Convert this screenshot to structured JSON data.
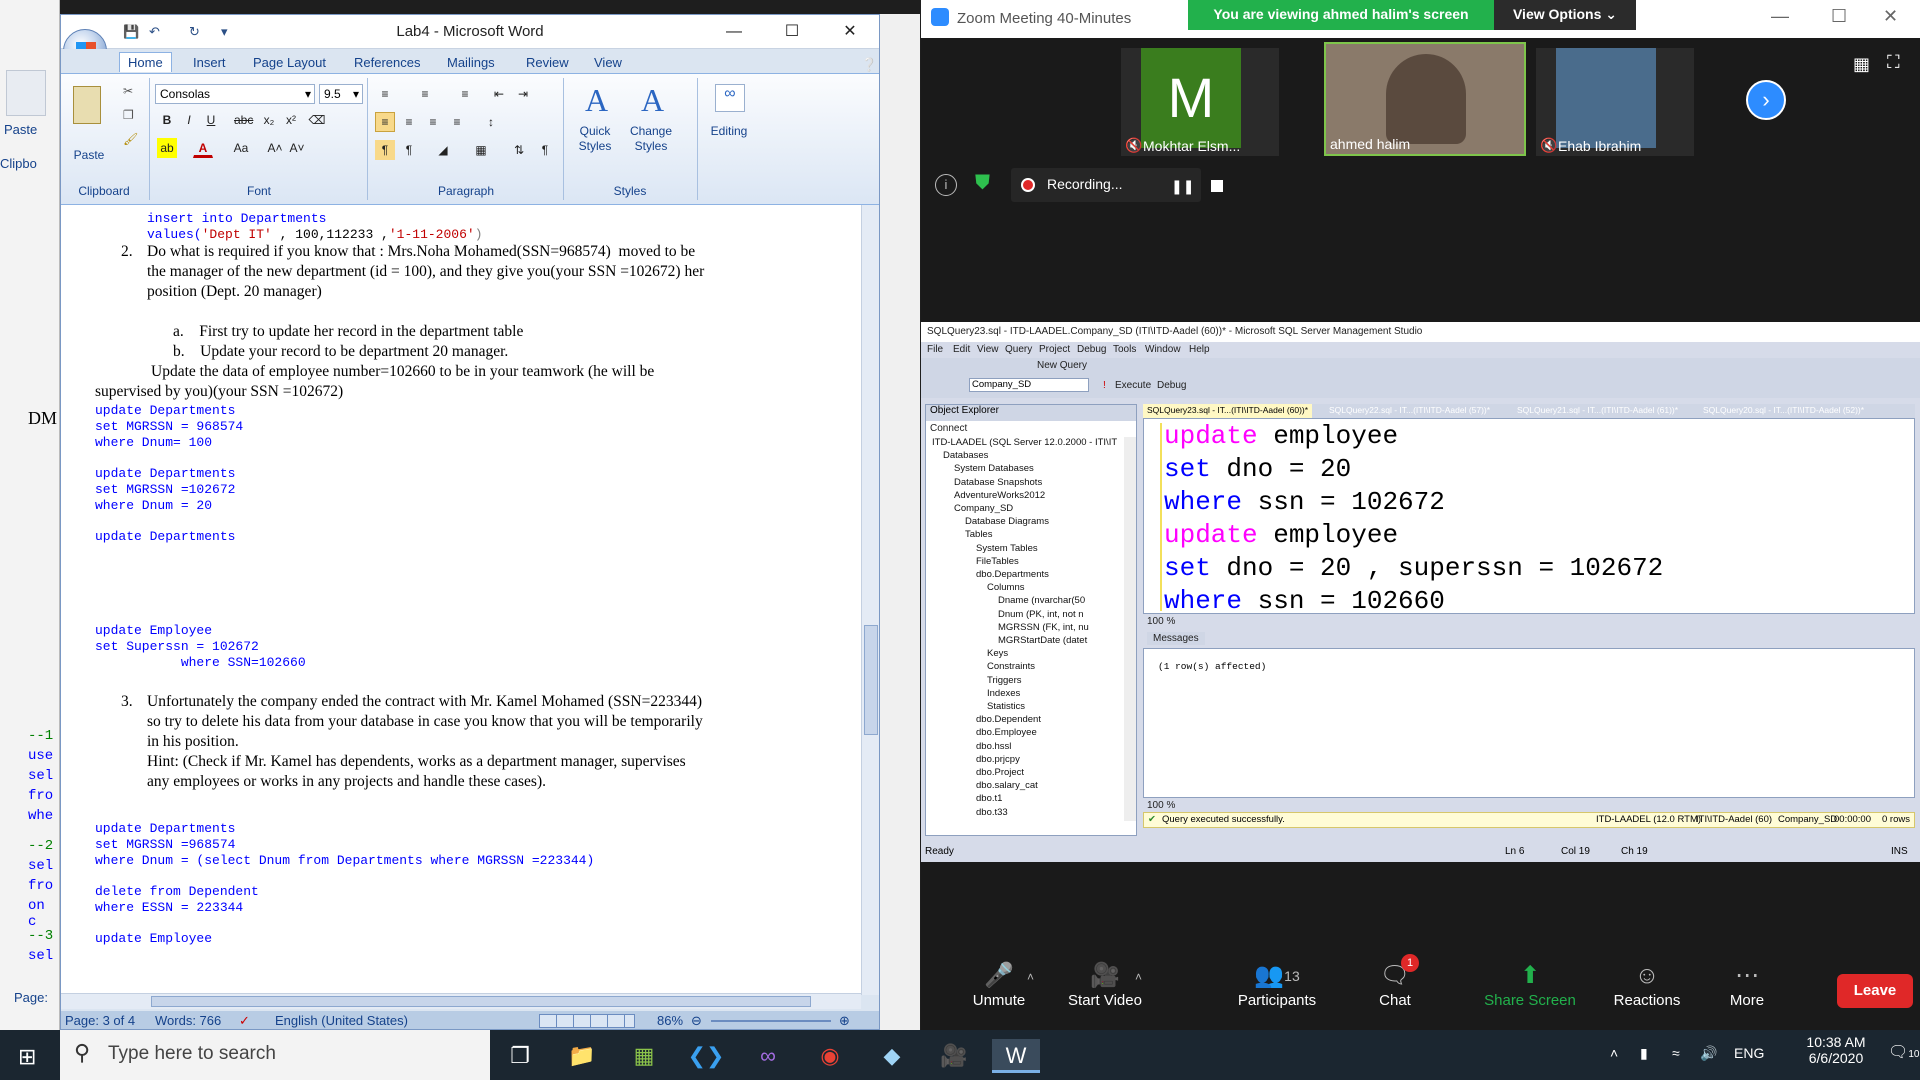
{
  "background_app": {
    "labels": [
      "Paste",
      "Clipbo",
      "DM",
      "--1",
      "use",
      "sel",
      "fro",
      "whe",
      "--2",
      "sel",
      "fro",
      "on c",
      "--3",
      "sel",
      "Page:"
    ]
  },
  "word": {
    "title": "Lab4 - Microsoft Word",
    "tabs": [
      "Home",
      "Insert",
      "Page Layout",
      "References",
      "Mailings",
      "Review",
      "View"
    ],
    "font": "Consolas",
    "font_size": "9.5",
    "groups": {
      "clipboard": "Clipboard",
      "font": "Font",
      "paragraph": "Paragraph",
      "styles": "Styles"
    },
    "buttons": {
      "paste": "Paste",
      "quick_styles": "Quick Styles",
      "change_styles": "Change Styles",
      "editing": "Editing"
    },
    "doc": {
      "l1": "insert into Departments",
      "l2a": "values(",
      "l2b": "'Dept IT'",
      "l2c": " , 100,112233 ,",
      "l2d": "'1-11-2006'",
      "l2e": ")",
      "q2num": "2.",
      "q2a": "Do what is required if you know that : Mrs.Noha Mohamed(SSN=968574)  moved to be",
      "q2b": "the manager of the new department (id = 100), and they give you(your SSN =102672) her",
      "q2c": "position (Dept. 20 manager)",
      "qa": "a.    First try to update her record in the department table",
      "qb": "b.    Update your record to be department 20 manager.",
      "qc1": "Update the data of employee number=102660 to be in your teamwork (he will be",
      "qc2": "supervised by you)(your SSN =102672)",
      "c1": "update Departments",
      "c2": "set MGRSSN = 968574",
      "c3": "where Dnum= 100",
      "c4": "update Departments",
      "c5": "set MGRSSN =102672",
      "c6": "where Dnum = 20",
      "c7": "update Departments",
      "c8": "update Employee",
      "c9": "set Superssn = 102672",
      "c10": "           where SSN=102660",
      "q3num": "3.",
      "q3a": "Unfortunately the company ended the contract with Mr. Kamel Mohamed (SSN=223344)",
      "q3b": "so try to delete his data from your database in case you know that you will be temporarily",
      "q3c": "in his position.",
      "q3d": "Hint: (Check if Mr. Kamel has dependents, works as a department manager, supervises",
      "q3e": "any employees or works in any projects and handle these cases).",
      "c11": "update Departments",
      "c12": "set MGRSSN =968574",
      "c13": "where Dnum = (select Dnum from Departments where MGRSSN =223344)",
      "c14": "delete from Dependent",
      "c15": "where ESSN = 223344",
      "c16": "update Employee"
    },
    "status": {
      "page": "Page: 3 of 4",
      "words": "Words: 766",
      "lang": "English (United States)",
      "zoom": "86%"
    }
  },
  "zoom": {
    "title": "Zoom Meeting 40-Minutes",
    "viewing": "You are viewing ahmed halim's screen",
    "view_options": "View Options",
    "participants": [
      {
        "name": "Mokhtar Elsm...",
        "initial": "M",
        "color": "#3a7d1e"
      },
      {
        "name": "ahmed halim"
      },
      {
        "name": "Ehab Ibrahim"
      }
    ],
    "recording": "Recording...",
    "controls": {
      "unmute": "Unmute",
      "start_video": "Start Video",
      "participants": "Participants",
      "participants_count": "13",
      "chat": "Chat",
      "chat_badge": "1",
      "share": "Share Screen",
      "reactions": "Reactions",
      "more": "More",
      "leave": "Leave"
    }
  },
  "ssms": {
    "title": "SQLQuery23.sql - ITD-LAADEL.Company_SD (ITI\\ITD-Aadel (60))* - Microsoft SQL Server Management Studio",
    "menu": [
      "File",
      "Edit",
      "View",
      "Query",
      "Project",
      "Debug",
      "Tools",
      "Window",
      "Help"
    ],
    "new_query": "New Query",
    "db": "Company_SD",
    "execute": "Execute",
    "debug": "Debug",
    "tabs": [
      "SQLQuery23.sql - IT...(ITI\\ITD-Aadel (60))*",
      "SQLQuery22.sql - IT...(ITI\\ITD-Aadel (57))*",
      "SQLQuery21.sql - IT...(ITI\\ITD-Aadel (61))*",
      "SQLQuery20.sql - IT...(ITI\\ITD-Aadel (52))*"
    ],
    "oe_title": "Object Explorer",
    "connect": "Connect",
    "tree": [
      "ITD-LAADEL (SQL Server 12.0.2000 - ITI\\IT",
      "Databases",
      "System Databases",
      "Database Snapshots",
      "AdventureWorks2012",
      "Company_SD",
      "Database Diagrams",
      "Tables",
      "System Tables",
      "FileTables",
      "dbo.Departments",
      "Columns",
      "Dname (nvarchar(50",
      "Dnum (PK, int, not n",
      "MGRSSN (FK, int, nu",
      "MGRStartDate (datet",
      "Keys",
      "Constraints",
      "Triggers",
      "Indexes",
      "Statistics",
      "dbo.Dependent",
      "dbo.Employee",
      "dbo.hssl",
      "dbo.prjcpy",
      "dbo.Project",
      "dbo.salary_cat",
      "dbo.t1",
      "dbo.t33"
    ],
    "sql": [
      [
        "update",
        " employee"
      ],
      [
        "set",
        " dno = 20"
      ],
      [
        "where",
        " ssn = 102672"
      ],
      [
        "update",
        " employee"
      ],
      [
        "set",
        " dno = 20 , superssn = 102672"
      ],
      [
        "where",
        " ssn = 102660"
      ]
    ],
    "zoom_level": "100 %",
    "messages_tab": "Messages",
    "message": "(1 row(s) affected)",
    "success": "Query executed successfully.",
    "server": "ITD-LAADEL (12.0 RTM)",
    "user": "ITI\\ITD-Aadel (60)",
    "dbname": "Company_SD",
    "time": "00:00:00",
    "rows": "0 rows",
    "ready": "Ready",
    "ln": "Ln 6",
    "col": "Col 19",
    "ch": "Ch 19",
    "ins": "INS"
  },
  "taskbar": {
    "search_placeholder": "Type here to search",
    "lang": "ENG",
    "time": "10:38 AM",
    "date": "6/6/2020",
    "notif": "10"
  }
}
